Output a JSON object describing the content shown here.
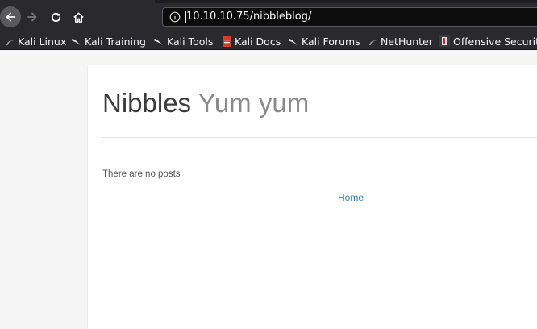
{
  "browser": {
    "url": "10.10.10.75/nibbleblog/",
    "bookmarks": [
      {
        "label": "Kali Linux",
        "icon": "kali-dragon-icon"
      },
      {
        "label": "Kali Training",
        "icon": "kali-dragon-icon"
      },
      {
        "label": "Kali Tools",
        "icon": "kali-dragon-icon"
      },
      {
        "label": "Kali Docs",
        "icon": "kali-docs-icon"
      },
      {
        "label": "Kali Forums",
        "icon": "kali-dragon-icon"
      },
      {
        "label": "NetHunter",
        "icon": "nethunter-icon"
      },
      {
        "label": "Offensive Security",
        "icon": "offsec-icon"
      }
    ]
  },
  "page": {
    "blog_name": "Nibbles",
    "blog_slogan": "Yum yum",
    "no_posts": "There are no posts",
    "home_link": "Home"
  },
  "colors": {
    "chrome": "#2a2a2e",
    "urlbar": "#0c0c0d",
    "link": "#2a7ec4"
  }
}
